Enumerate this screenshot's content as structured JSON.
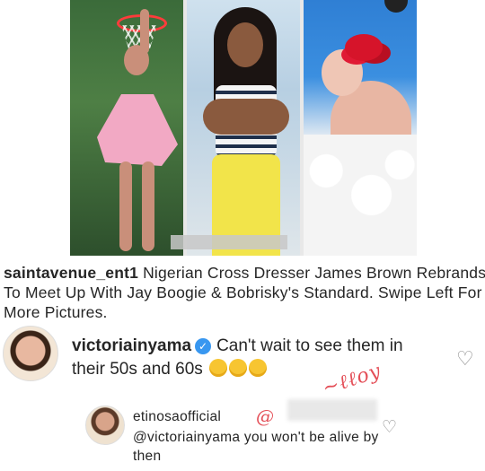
{
  "post": {
    "images": [
      {
        "subject": "person posing under basketball hoop in pink outfit"
      },
      {
        "subject": "person in striped top and yellow skirt"
      },
      {
        "subject": "person in bubble bath with red flower"
      }
    ]
  },
  "caption": {
    "username": "saintavenue_ent1",
    "text": "Nigerian Cross Dresser James Brown Rebrands To Meet Up With Jay Boogie & Bobrisky's Standard. Swipe Left For More Pictures."
  },
  "comments": [
    {
      "username": "victoriainyama",
      "verified": true,
      "text": "Can't wait to see them in their 50s and 60s",
      "emoji_count": 3,
      "emoji": "rolling-on-floor-laughing",
      "like_icon": "heart-outline-icon"
    },
    {
      "username": "etinosaofficial",
      "mention": "@victoriainyama",
      "text": "you won't be alive by then",
      "like_icon": "heart-outline-icon"
    }
  ],
  "colors": {
    "text": "#262626",
    "verified_badge": "#3897f0",
    "icon_gray": "#8e8e8e",
    "watermark_red": "#e0313b"
  }
}
